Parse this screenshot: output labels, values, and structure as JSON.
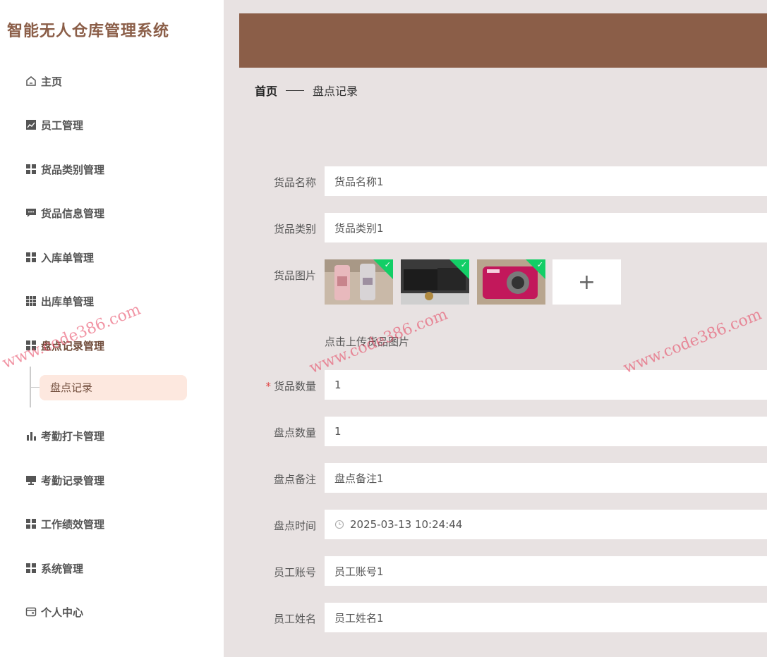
{
  "app_title": "智能无人仓库管理系统",
  "nav": [
    {
      "label": "主页",
      "icon": "home-icon"
    },
    {
      "label": "员工管理",
      "icon": "chart-icon"
    },
    {
      "label": "货品类别管理",
      "icon": "grid-icon"
    },
    {
      "label": "货品信息管理",
      "icon": "message-icon"
    },
    {
      "label": "入库单管理",
      "icon": "grid-icon"
    },
    {
      "label": "出库单管理",
      "icon": "grid-nine-icon"
    },
    {
      "label": "盘点记录管理",
      "icon": "grid-icon"
    },
    {
      "label": "考勤打卡管理",
      "icon": "bar-chart-icon"
    },
    {
      "label": "考勤记录管理",
      "icon": "monitor-icon"
    },
    {
      "label": "工作绩效管理",
      "icon": "grid-icon"
    },
    {
      "label": "系统管理",
      "icon": "grid-icon"
    },
    {
      "label": "个人中心",
      "icon": "card-icon"
    }
  ],
  "submenu": {
    "label": "盘点记录"
  },
  "breadcrumb": {
    "home": "首页",
    "current": "盘点记录"
  },
  "form": {
    "name_label": "货品名称",
    "name_value": "货品名称1",
    "category_label": "货品类别",
    "category_value": "货品类别1",
    "image_label": "货品图片",
    "upload_hint": "点击上传货品图片",
    "qty_label": "货品数量",
    "qty_value": "1",
    "check_qty_label": "盘点数量",
    "check_qty_value": "1",
    "remark_label": "盘点备注",
    "remark_value": "盘点备注1",
    "time_label": "盘点时间",
    "time_value": "2025-03-13 10:24:44",
    "account_label": "员工账号",
    "account_value": "员工账号1",
    "staff_name_label": "员工姓名",
    "staff_name_value": "员工姓名1"
  },
  "watermark": "www.code386.com",
  "colors": {
    "brand": "#8b5e48",
    "active_bg": "#fde8df",
    "background": "#e8e2e2",
    "check": "#13ce66"
  }
}
